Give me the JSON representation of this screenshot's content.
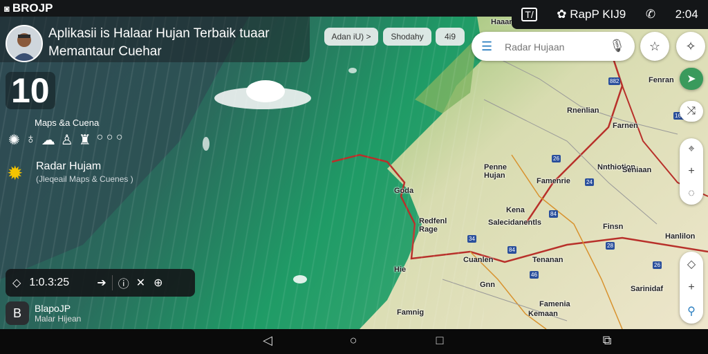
{
  "status_bar": {
    "app_badge": "BROJP",
    "right_label": "RapP KIJ9",
    "time": "2:04"
  },
  "header": {
    "headline": "Aplikasii is Halaar Hujan Terbaik tuaar Memantaur Cuehar",
    "big_value": "10",
    "maps_label": "Maps &a Cuena",
    "weather_icons": [
      "wind-icon",
      "rain-drop-icon",
      "cloud-icon",
      "person-icon",
      "thermometer-icon",
      "dots-icon"
    ]
  },
  "radar": {
    "title": "Radar Hujam",
    "subtitle": "(Jleqeail Maps & Cuenes )"
  },
  "chips": [
    "Adan iU) >",
    "Shodahy",
    "4i9"
  ],
  "search": {
    "placeholder": "Radar Hujaan"
  },
  "player": {
    "time": "1:0.3:25"
  },
  "app_card": {
    "name": "BlapoJP",
    "subtitle": "Malar Hijean"
  },
  "map_labels": {
    "cities": [
      "Haaar",
      "Fenran",
      "Rnenlian",
      "Farnen",
      "Penne Hujan",
      "Nnthiotion",
      "Famenrie",
      "Goda",
      "Kena",
      "Redfenl Rage",
      "Salecidanentls",
      "Finsn",
      "Cuanlen",
      "Tenanan",
      "Hie",
      "Famenia",
      "Hanlilon",
      "Gnn",
      "Sarinidaf",
      "Famnig",
      "Seniaan",
      "Kemaan"
    ],
    "shields": [
      "882",
      "166",
      "26",
      "24",
      "84",
      "84",
      "28",
      "26",
      "46",
      "34"
    ]
  },
  "scale_label": "— — — — — —",
  "colors": {
    "ocean_dark": "#1b3a46",
    "ocean_green": "#2fa76a",
    "land": "#e7e2c6",
    "road": "#b8302a",
    "accent": "#2a7ec0"
  }
}
